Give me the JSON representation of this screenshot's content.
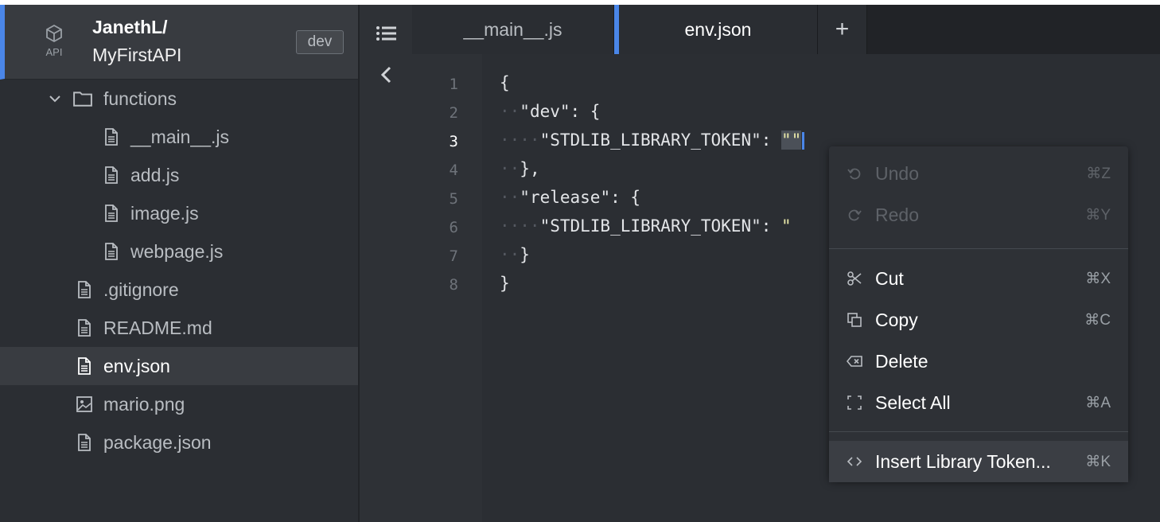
{
  "project": {
    "icon_label": "API",
    "owner": "JanethL/",
    "name": "MyFirstAPI",
    "env": "dev"
  },
  "tree": {
    "folder": "functions",
    "folder_children": [
      "__main__.js",
      "add.js",
      "image.js",
      "webpage.js"
    ],
    "root_files": [
      ".gitignore",
      "README.md",
      "env.json",
      "mario.png",
      "package.json"
    ],
    "active": "env.json"
  },
  "tabs": [
    {
      "label": "__main__.js"
    },
    {
      "label": "env.json"
    },
    {
      "label": "+"
    }
  ],
  "editor": {
    "current_line": 3,
    "line_numbers": [
      "1",
      "2",
      "3",
      "4",
      "5",
      "6",
      "7",
      "8"
    ],
    "lines": {
      "l1": "{",
      "l2_key": "\"dev\"",
      "l2_rest": ": {",
      "l3_key": "\"STDLIB_LIBRARY_TOKEN\"",
      "l3_colon": ": ",
      "l3_val": "\"\"",
      "l4": "},",
      "l5_key": "\"release\"",
      "l5_rest": ": {",
      "l6_key": "\"STDLIB_LIBRARY_TOKEN\"",
      "l6_colon": ": ",
      "l6_val": "\"",
      "l7": "}",
      "l8": "}"
    }
  },
  "context_menu": {
    "items": [
      {
        "label": "Undo",
        "shortcut": "⌘Z",
        "enabled": false,
        "icon": "undo-icon"
      },
      {
        "label": "Redo",
        "shortcut": "⌘Y",
        "enabled": false,
        "icon": "redo-icon"
      },
      {
        "label": "Cut",
        "shortcut": "⌘X",
        "enabled": true,
        "icon": "scissors-icon"
      },
      {
        "label": "Copy",
        "shortcut": "⌘C",
        "enabled": true,
        "icon": "copy-icon"
      },
      {
        "label": "Delete",
        "shortcut": "",
        "enabled": true,
        "icon": "backspace-icon"
      },
      {
        "label": "Select All",
        "shortcut": "⌘A",
        "enabled": true,
        "icon": "select-all-icon"
      },
      {
        "label": "Insert Library Token...",
        "shortcut": "⌘K",
        "enabled": true,
        "icon": "code-icon"
      }
    ]
  },
  "colors": {
    "accent": "#4a86e8",
    "string": "#e8e7a8"
  }
}
